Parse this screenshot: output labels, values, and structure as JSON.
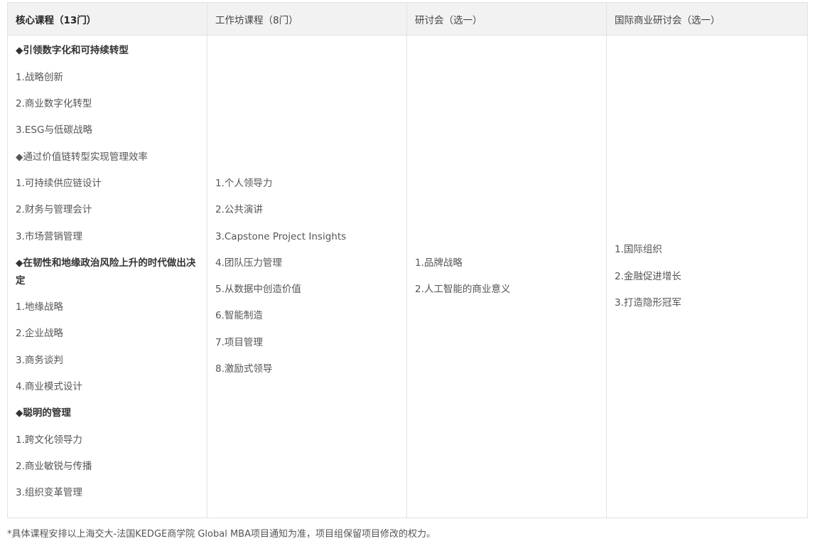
{
  "table": {
    "headers": [
      "核心课程（13门）",
      "工作坊课程（8门）",
      "研讨会（选一）",
      "国际商业研讨会（选一）"
    ],
    "core_courses": [
      {
        "text": "◆引领数字化和可持续转型",
        "section": true
      },
      {
        "text": "1.战略创新",
        "section": false
      },
      {
        "text": "2.商业数字化转型",
        "section": false
      },
      {
        "text": "3.ESG与低碳战略",
        "section": false
      },
      {
        "text": "◆通过价值链转型实现管理效率",
        "section": false
      },
      {
        "text": "1.可持续供应链设计",
        "section": false
      },
      {
        "text": "2.财务与管理会计",
        "section": false
      },
      {
        "text": "3.市场营销管理",
        "section": false
      },
      {
        "text": "◆在韧性和地缘政治风险上升的时代做出决定",
        "section": true
      },
      {
        "text": "1.地缘战略",
        "section": false
      },
      {
        "text": "2.企业战略",
        "section": false
      },
      {
        "text": "3.商务谈判",
        "section": false
      },
      {
        "text": "4.商业模式设计",
        "section": false
      },
      {
        "text": "◆聪明的管理",
        "section": true
      },
      {
        "text": "1.跨文化领导力",
        "section": false
      },
      {
        "text": "2.商业敏锐与传播",
        "section": false
      },
      {
        "text": "3.组织变革管理",
        "section": false
      }
    ],
    "workshop_courses": [
      "1.个人领导力",
      "2.公共演讲",
      "3.Capstone Project Insights",
      "4.团队压力管理",
      "5.从数据中创造价值",
      "6.智能制造",
      "7.项目管理",
      "8.激励式领导"
    ],
    "seminars": [
      "1.品牌战略",
      "2.人工智能的商业意义"
    ],
    "international_seminars": [
      "1.国际组织",
      "2.金融促进增长",
      "3.打造隐形冠军"
    ]
  },
  "footnote": "*具体课程安排以上海交大-法国KEDGE商学院 Global MBA项目通知为准，项目组保留项目修改的权力。"
}
